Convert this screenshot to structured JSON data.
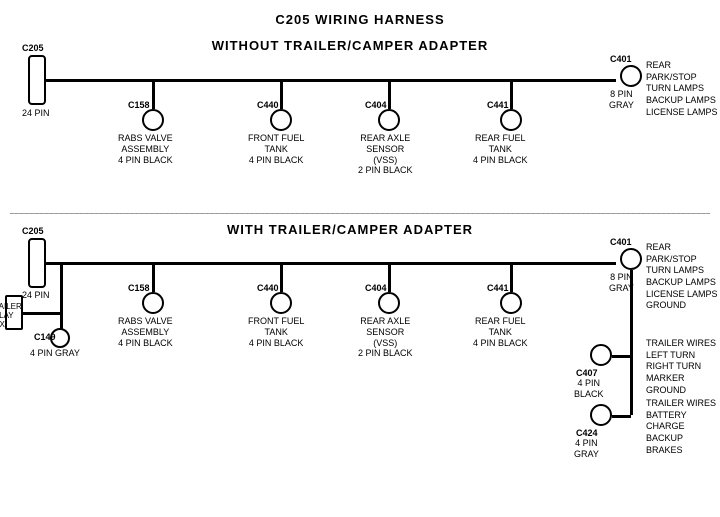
{
  "title": "C205 WIRING HARNESS",
  "section1": {
    "label": "WITHOUT  TRAILER/CAMPER ADAPTER",
    "left_connector": {
      "id": "C205",
      "pin_label": "24 PIN"
    },
    "right_connector": {
      "id": "C401",
      "pin_label": "8 PIN\nGRAY",
      "desc": "REAR PARK/STOP\nTURN LAMPS\nBACKUP LAMPS\nLICENSE LAMPS"
    },
    "connectors": [
      {
        "id": "C158",
        "desc": "RABS VALVE\nASSEMBLY\n4 PIN BLACK"
      },
      {
        "id": "C440",
        "desc": "FRONT FUEL\nTANK\n4 PIN BLACK"
      },
      {
        "id": "C404",
        "desc": "REAR AXLE\nSENSOR\n(VSS)\n2 PIN BLACK"
      },
      {
        "id": "C441",
        "desc": "REAR FUEL\nTANK\n4 PIN BLACK"
      }
    ]
  },
  "section2": {
    "label": "WITH TRAILER/CAMPER ADAPTER",
    "left_connector": {
      "id": "C205",
      "pin_label": "24 PIN"
    },
    "right_connector": {
      "id": "C401",
      "pin_label": "8 PIN\nGRAY",
      "desc": "REAR PARK/STOP\nTURN LAMPS\nBACKUP LAMPS\nLICENSE LAMPS\nGROUND"
    },
    "extra_left": {
      "box_label": "TRAILER\nRELAY\nBOX",
      "id": "C149",
      "pin_label": "4 PIN GRAY"
    },
    "connectors": [
      {
        "id": "C158",
        "desc": "RABS VALVE\nASSEMBLY\n4 PIN BLACK"
      },
      {
        "id": "C440",
        "desc": "FRONT FUEL\nTANK\n4 PIN BLACK"
      },
      {
        "id": "C404",
        "desc": "REAR AXLE\nSENSOR\n(VSS)\n2 PIN BLACK"
      },
      {
        "id": "C441",
        "desc": "REAR FUEL\nTANK\n4 PIN BLACK"
      }
    ],
    "extra_right_top": {
      "id": "C407",
      "pin_label": "4 PIN\nBLACK",
      "desc": "TRAILER WIRES\nLEFT TURN\nRIGHT TURN\nMARKER\nGROUND"
    },
    "extra_right_bottom": {
      "id": "C424",
      "pin_label": "4 PIN\nGRAY",
      "desc": "TRAILER WIRES\nBATTERY CHARGE\nBACKUP\nBRAKES"
    }
  }
}
